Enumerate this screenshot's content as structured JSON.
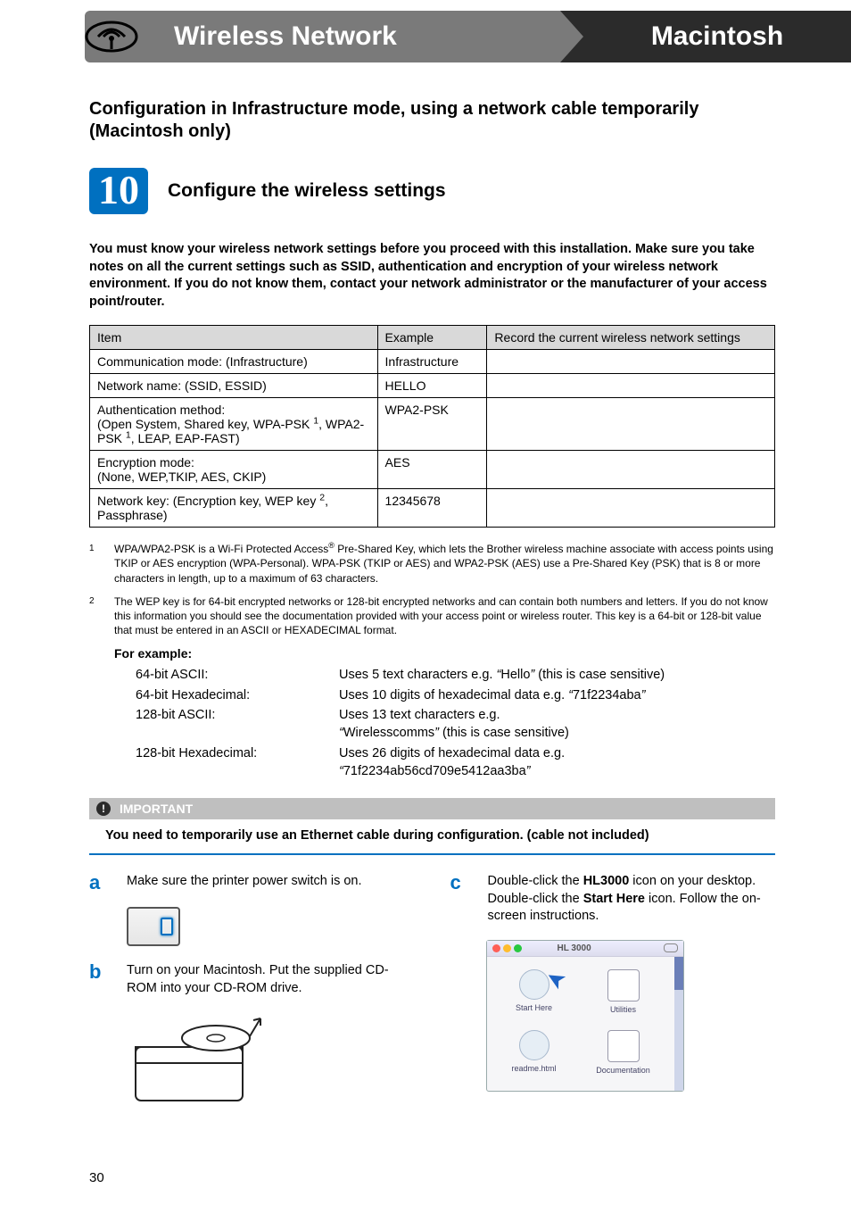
{
  "header": {
    "left": "Wireless Network",
    "right": "Macintosh"
  },
  "section_title": "Configuration in Infrastructure mode, using a network cable temporarily (Macintosh only)",
  "step": {
    "number": "10",
    "title": "Configure the wireless settings"
  },
  "intro": "You must know your wireless network settings before you proceed with this installation. Make sure you take notes on all the current settings such as SSID, authentication and encryption of your wireless network environment. If you do not know them, contact your network administrator or the manufacturer of your access point/router.",
  "table": {
    "headers": [
      "Item",
      "Example",
      "Record the current wireless network settings"
    ],
    "rows": [
      {
        "item": "Communication mode: (Infrastructure)",
        "example": "Infrastructure",
        "record": ""
      },
      {
        "item": "Network name: (SSID, ESSID)",
        "example": "HELLO",
        "record": ""
      },
      {
        "item_html": "Authentication method:<br>(Open System, Shared key, WPA-PSK <sup>1</sup>, WPA2-PSK <sup>1</sup>, LEAP, EAP-FAST)",
        "example": "WPA2-PSK",
        "record": ""
      },
      {
        "item_html": "Encryption mode:<br>(None, WEP,TKIP, AES, CKIP)",
        "example": "AES",
        "record": ""
      },
      {
        "item_html": "Network key: (Encryption key, WEP key <sup>2</sup>, Passphrase)",
        "example": "12345678",
        "record": ""
      }
    ]
  },
  "footnotes": [
    {
      "num": "1",
      "text_html": "WPA/WPA2-PSK is a Wi-Fi Protected Access<sup>®</sup> Pre-Shared Key, which lets the Brother wireless machine associate with access points using TKIP or AES encryption (WPA-Personal). WPA-PSK (TKIP or AES) and WPA2-PSK (AES) use a Pre-Shared Key (PSK) that is 8 or more characters in length, up to a maximum of 63 characters."
    },
    {
      "num": "2",
      "text": "The WEP key is for 64-bit encrypted networks or 128-bit encrypted networks and can contain both numbers and letters. If you do not know this information you should see the documentation provided with your access point or wireless router. This key is a 64-bit or 128-bit value that must be entered in an ASCII or HEXADECIMAL format."
    }
  ],
  "for_example_heading": "For example:",
  "examples": [
    {
      "label": "64-bit ASCII:",
      "desc_html": "Uses 5 text characters e.g. <em>&ldquo;</em>Hello<em>&rdquo;</em> (this is case sensitive)"
    },
    {
      "label": "64-bit Hexadecimal:",
      "desc_html": "Uses 10 digits of hexadecimal data e.g. <em>&ldquo;</em>71f2234aba<em>&rdquo;</em>"
    },
    {
      "label": "128-bit ASCII:",
      "desc_html": "Uses 13 text characters e.g.<br><em>&ldquo;</em>Wirelesscomms<em>&rdquo;</em> (this is case sensitive)"
    },
    {
      "label": "128-bit Hexadecimal:",
      "desc_html": "Uses 26 digits of hexadecimal data e.g.<br><em>&ldquo;</em>71f2234ab56cd709e5412aa3ba<em>&rdquo;</em>"
    }
  ],
  "important": {
    "label": "IMPORTANT",
    "text": "You need to temporarily use an Ethernet cable during configuration. (cable not included)"
  },
  "substeps": {
    "a": {
      "letter": "a",
      "text": "Make sure the printer power switch is on."
    },
    "b": {
      "letter": "b",
      "text": "Turn on your Macintosh. Put the supplied CD-ROM into your CD-ROM drive."
    },
    "c": {
      "letter": "c",
      "text_html": "Double-click the <b>HL3000</b> icon on your desktop. Double-click the <b>Start Here</b> icon. Follow the on-screen instructions."
    }
  },
  "finder": {
    "title": "HL 3000",
    "icons": [
      {
        "name": "Start Here",
        "shape": "circle"
      },
      {
        "name": "Utilities",
        "shape": "box"
      },
      {
        "name": "readme.html",
        "shape": "circle"
      },
      {
        "name": "Documentation",
        "shape": "box"
      }
    ]
  },
  "page_number": "30"
}
